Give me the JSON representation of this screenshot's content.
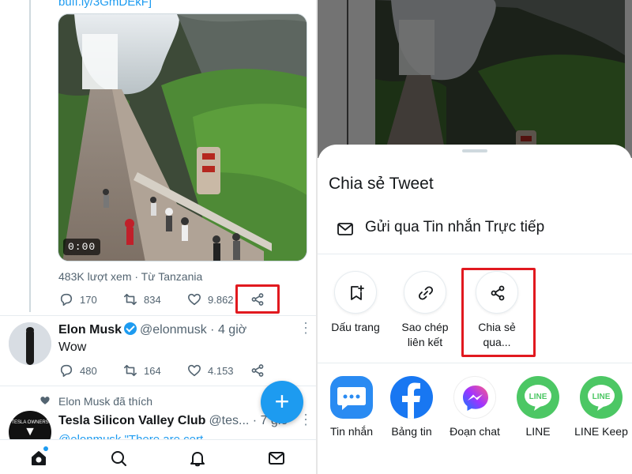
{
  "left": {
    "link_text": "buff.ly/3GmDEkF]",
    "video": {
      "duration": "0:00"
    },
    "views_line": "483K lượt xem · Từ Tanzania",
    "actions": {
      "reply": "170",
      "retweet": "834",
      "like": "9.862"
    },
    "tweet": {
      "name": "Elon Musk",
      "handle": "@elonmusk · 4 giờ",
      "body": "Wow",
      "reply": "480",
      "retweet": "164",
      "like": "4.153"
    },
    "liked_line": "Elon Musk đã thích",
    "tweet2": {
      "name": "Tesla Silicon Valley Club",
      "handle": "@tes... · 7 giờ",
      "preview": "@elonmusk \"There are cert..."
    },
    "fab_label": "+"
  },
  "right": {
    "sheet_title": "Chia sẻ Tweet",
    "dm_label": "Gửi qua Tin nhắn Trực tiếp",
    "options": [
      {
        "line1": "Dấu trang",
        "line2": ""
      },
      {
        "line1": "Sao chép",
        "line2": "liên kết"
      },
      {
        "line1": "Chia sẻ",
        "line2": "qua..."
      }
    ],
    "apps": [
      {
        "label": "Tin nhắn",
        "color": "#2a8bf2"
      },
      {
        "label": "Bảng tin",
        "color": "#1877f2"
      },
      {
        "label": "Đoạn chat",
        "color": "#ffffff"
      },
      {
        "label": "LINE",
        "color": "#4cc764"
      },
      {
        "label": "LINE Keep",
        "color": "#4cc764"
      }
    ]
  },
  "colors": {
    "highlight": "#e1191f",
    "accent": "#1d9bf0"
  }
}
